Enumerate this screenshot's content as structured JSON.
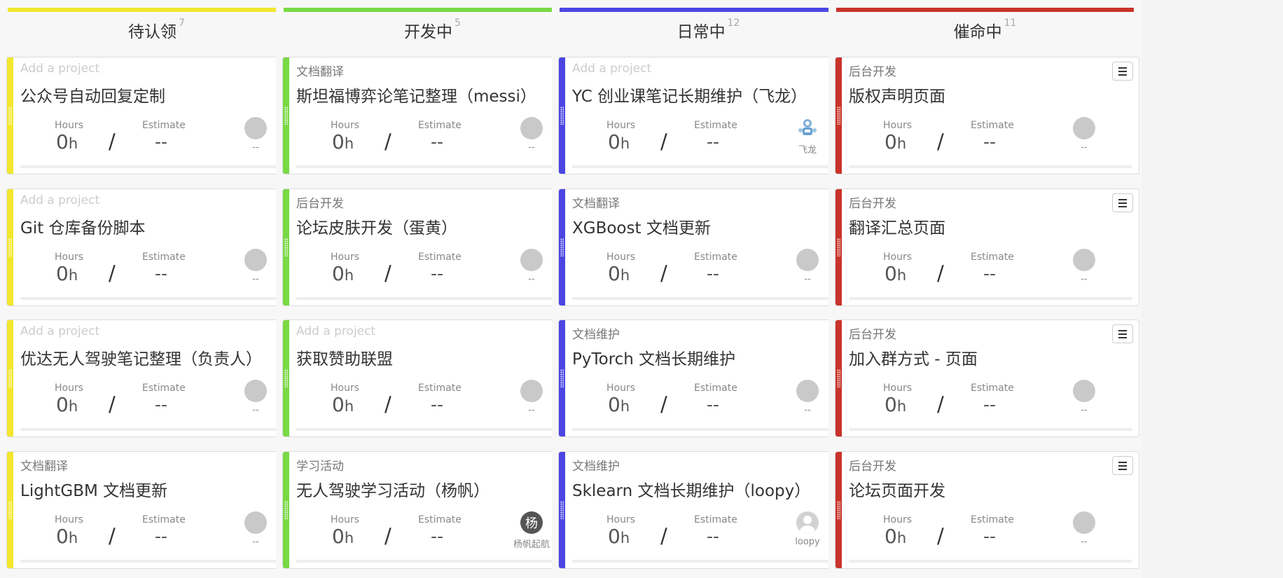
{
  "colors": {
    "yellow": "#f2e72c",
    "green": "#79d944",
    "blue": "#4b46e3",
    "red": "#c8332a",
    "cyan_background_blob": "#bff4f4"
  },
  "menu_icon": "hamburger-menu-icon",
  "labels": {
    "hours": "Hours",
    "estimate": "Estimate",
    "hours_unit": "h"
  },
  "columns": [
    {
      "title": "待认领",
      "count": "7",
      "color": "#f2e72c",
      "cards": [
        {
          "project": "Add a project",
          "project_empty": true,
          "title": "公众号自动回复定制",
          "hours": "0",
          "estimate": "--",
          "assignee": "--",
          "avatar": "placeholder"
        },
        {
          "project": "Add a project",
          "project_empty": true,
          "title": "Git 仓库备份脚本",
          "hours": "0",
          "estimate": "--",
          "assignee": "--",
          "avatar": "placeholder"
        },
        {
          "project": "Add a project",
          "project_empty": true,
          "title": "优达无人驾驶笔记整理（负责人）",
          "hours": "0",
          "estimate": "--",
          "assignee": "--",
          "avatar": "placeholder"
        },
        {
          "project": "文档翻译",
          "project_empty": false,
          "title": "LightGBM 文档更新",
          "hours": "0",
          "estimate": "--",
          "assignee": "--",
          "avatar": "placeholder"
        }
      ]
    },
    {
      "title": "开发中",
      "count": "5",
      "color": "#79d944",
      "cards": [
        {
          "project": "文档翻译",
          "project_empty": false,
          "title": "斯坦福博弈论笔记整理（messi）",
          "hours": "0",
          "estimate": "--",
          "assignee": "--",
          "avatar": "placeholder"
        },
        {
          "project": "后台开发",
          "project_empty": false,
          "title": "论坛皮肤开发（蛋黄）",
          "hours": "0",
          "estimate": "--",
          "assignee": "--",
          "avatar": "placeholder"
        },
        {
          "project": "Add a project",
          "project_empty": true,
          "title": "获取赞助联盟",
          "hours": "0",
          "estimate": "--",
          "assignee": "--",
          "avatar": "placeholder"
        },
        {
          "project": "学习活动",
          "project_empty": false,
          "title": "无人驾驶学习活动（杨帆）",
          "hours": "0",
          "estimate": "--",
          "assignee": "杨帆起航",
          "avatar": "initial",
          "avatar_text": "杨"
        }
      ]
    },
    {
      "title": "日常中",
      "count": "12",
      "color": "#4b46e3",
      "cards": [
        {
          "project": "Add a project",
          "project_empty": true,
          "title": "YC 创业课笔记长期维护（飞龙）",
          "hours": "0",
          "estimate": "--",
          "assignee": "飞龙",
          "avatar": "robot"
        },
        {
          "project": "文档翻译",
          "project_empty": false,
          "title": "XGBoost 文档更新",
          "hours": "0",
          "estimate": "--",
          "assignee": "--",
          "avatar": "placeholder"
        },
        {
          "project": "文档维护",
          "project_empty": false,
          "title": "PyTorch 文档长期维护",
          "hours": "0",
          "estimate": "--",
          "assignee": "--",
          "avatar": "placeholder"
        },
        {
          "project": "文档维护",
          "project_empty": false,
          "title": "Sklearn 文档长期维护（loopy）",
          "hours": "0",
          "estimate": "--",
          "assignee": "loopy",
          "avatar": "user-placeholder"
        }
      ]
    },
    {
      "title": "催命中",
      "count": "11",
      "color": "#c8332a",
      "cards": [
        {
          "project": "后台开发",
          "project_empty": false,
          "title": "版权声明页面",
          "hours": "0",
          "estimate": "--",
          "assignee": "--",
          "avatar": "placeholder"
        },
        {
          "project": "后台开发",
          "project_empty": false,
          "title": "翻译汇总页面",
          "hours": "0",
          "estimate": "--",
          "assignee": "--",
          "avatar": "placeholder"
        },
        {
          "project": "后台开发",
          "project_empty": false,
          "title": "加入群方式 - 页面",
          "hours": "0",
          "estimate": "--",
          "assignee": "--",
          "avatar": "placeholder"
        },
        {
          "project": "后台开发",
          "project_empty": false,
          "title": "论坛页面开发",
          "hours": "0",
          "estimate": "--",
          "assignee": "--",
          "avatar": "placeholder"
        }
      ]
    }
  ]
}
